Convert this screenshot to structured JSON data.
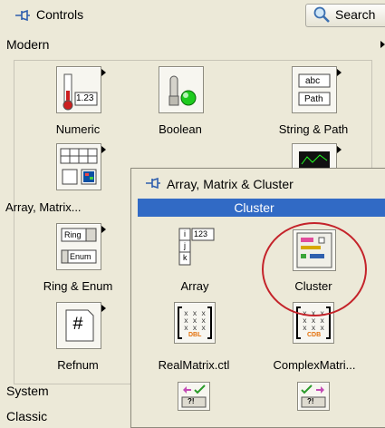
{
  "header": {
    "title": "Controls",
    "search_label": "Search",
    "category": "Modern"
  },
  "items": [
    {
      "label": "Numeric",
      "icon": "numeric-icon",
      "icon_text": "1.23"
    },
    {
      "label": "Boolean",
      "icon": "boolean-icon"
    },
    {
      "label": "String & Path",
      "icon": "string-path-icon",
      "icon_text_a": "abc",
      "icon_text_b": "Path"
    },
    {
      "label": "Array, Matrix...",
      "icon": "array-matrix-icon",
      "icon_text": "1 2 3 4"
    },
    {
      "label": "Ring & Enum",
      "icon": "ring-enum-icon",
      "icon_text_a": "Ring",
      "icon_text_b": "Enum"
    },
    {
      "label": "Refnum",
      "icon": "refnum-icon",
      "icon_text": "#"
    }
  ],
  "categories": {
    "system": "System",
    "classic": "Classic"
  },
  "subpalette": {
    "title": "Array, Matrix & Cluster",
    "highlighted": "Cluster",
    "items": [
      {
        "label": "Array",
        "icon": "array-icon",
        "icon_text": "123"
      },
      {
        "label": "Cluster",
        "icon": "cluster-icon"
      },
      {
        "label": "RealMatrix.ctl",
        "icon": "real-matrix-icon",
        "icon_text": "DBL"
      },
      {
        "label": "ComplexMatri...",
        "icon": "complex-matrix-icon",
        "icon_text": "CDB"
      }
    ],
    "bottom_icon_text": "?!"
  },
  "colors": {
    "highlight": "#316ac5",
    "annotation_ring": "#c4232a"
  }
}
